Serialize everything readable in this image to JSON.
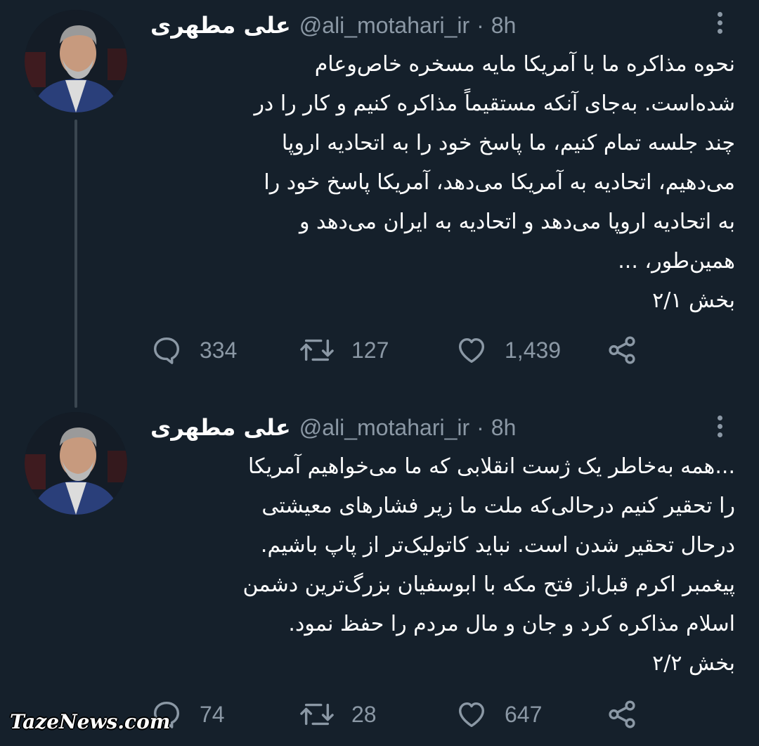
{
  "tweets": [
    {
      "display_name": "علی مطهری",
      "handle": "@ali_motahari_ir",
      "separator": "·",
      "time": "8h",
      "text": "نحوه مذاکره ما با آمریکا مایه مسخره خاص‌وعام\nشده‌است. به‌جای آنکه مستقیماً مذاکره کنیم و کار را در\nچند جلسه تمام کنیم، ما پاسخ خود را به اتحادیه اروپا\nمی‌دهیم، اتحادیه به آمریکا می‌دهد، آمریکا پاسخ خود را\nبه اتحادیه اروپا می‌دهد و اتحادیه به ایران می‌دهد و\nهمین‌طور، ...\nبخش ۲/۱",
      "replies": "334",
      "retweets": "127",
      "likes": "1,439"
    },
    {
      "display_name": "علی مطهری",
      "handle": "@ali_motahari_ir",
      "separator": "·",
      "time": "8h",
      "text": "...همه به‌خاطر یک ژست انقلابی که ما می‌خواهیم آمریکا\nرا تحقیر کنیم درحالی‌که ملت ما زیر فشارهای معیشتی\nدرحال تحقیر شدن است. نباید کاتولیک‌تر از پاپ باشیم.\nپیغمبر اکرم قبل‌از فتح مکه با ابوسفیان بزرگ‌ترین دشمن\nاسلام مذاکره کرد و جان و مال مردم را حفظ نمود.\nبخش ۲/۲",
      "replies": "74",
      "retweets": "28",
      "likes": "647"
    }
  ],
  "icons": {
    "reply": "reply-icon",
    "retweet": "retweet-icon",
    "like": "heart-icon",
    "share": "share-icon",
    "more": "more-vertical-icon"
  },
  "colors": {
    "background": "#15202b",
    "secondary_text": "#8b98a5",
    "thread_line": "#3a4650"
  },
  "watermark": "TazeNews.com"
}
